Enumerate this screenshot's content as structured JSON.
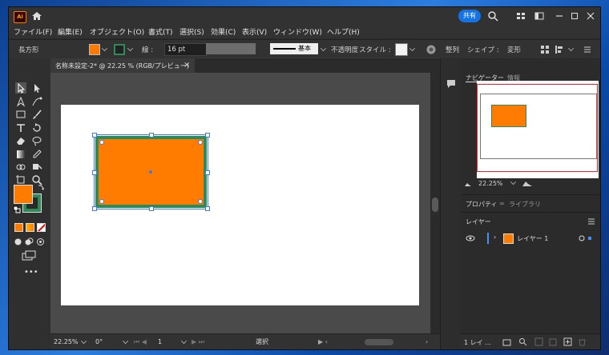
{
  "app": {
    "logo_text": "Ai",
    "share_label": "共有",
    "menus": [
      "ファイル(F)",
      "編集(E)",
      "オブジェクト(O)",
      "書式(T)",
      "選択(S)",
      "効果(C)",
      "表示(V)",
      "ウィンドウ(W)",
      "ヘルプ(H)"
    ]
  },
  "control_bar": {
    "object_type": "長方形",
    "stroke_label": "線 :",
    "stroke_weight": "16 pt",
    "brush_label": "基本",
    "opacity_label": "不透明度",
    "style_label": "スタイル :",
    "align_label": "整列",
    "shape_label": "シェイプ :",
    "transform_label": "変形"
  },
  "document": {
    "tab_title": "名称未設定-2* @ 22.25 % (RGB/プレビュー)",
    "close_symbol": "×"
  },
  "colors": {
    "fill": "#ff7c00",
    "stroke": "#2e8b57",
    "accent": "#1473e6"
  },
  "status": {
    "zoom": "22.25%",
    "rotation": "0°",
    "page": "1",
    "tool_name": "選択"
  },
  "navigator": {
    "tab_navigator": "ナビゲーター",
    "tab_info": "情報",
    "zoom": "22.25%"
  },
  "properties": {
    "tab_properties": "プロパティ",
    "tab_libraries": "ライブラリ"
  },
  "layers": {
    "tab_layers": "レイヤー",
    "layer_name": "レイヤー 1",
    "footer_label": "1 レイ ..."
  }
}
